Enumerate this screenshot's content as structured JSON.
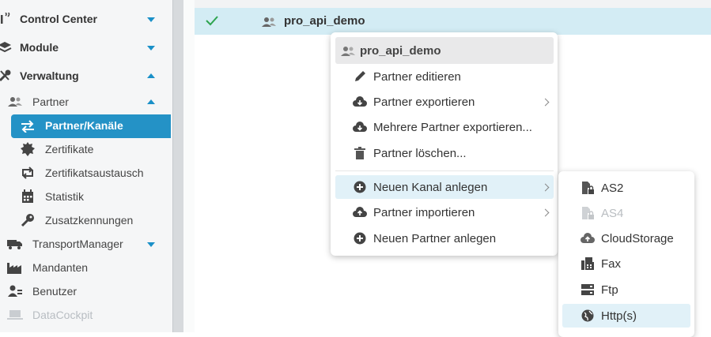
{
  "sidebar": {
    "top_items": [
      {
        "label": "Control Center"
      },
      {
        "label": "Module"
      },
      {
        "label": "Verwaltung"
      }
    ],
    "partner": {
      "label": "Partner"
    },
    "partner_children": [
      {
        "label": "Partner/Kanäle"
      },
      {
        "label": "Zertifikate"
      },
      {
        "label": "Zertifikatsaustausch"
      },
      {
        "label": "Statistik"
      },
      {
        "label": "Zusatzkennungen"
      }
    ],
    "other_items": [
      {
        "label": "TransportManager"
      },
      {
        "label": "Mandanten"
      },
      {
        "label": "Benutzer"
      },
      {
        "label": "DataCockpit"
      }
    ]
  },
  "list": {
    "selected_row": {
      "name": "pro_api_demo"
    }
  },
  "context_menu": {
    "header": "pro_api_demo",
    "items": [
      {
        "label": "Partner editieren"
      },
      {
        "label": "Partner exportieren"
      },
      {
        "label": "Mehrere Partner exportieren..."
      },
      {
        "label": "Partner löschen..."
      },
      {
        "label": "Neuen Kanal anlegen"
      },
      {
        "label": "Partner importieren"
      },
      {
        "label": "Neuen Partner anlegen"
      }
    ]
  },
  "submenu": {
    "items": [
      {
        "label": "AS2"
      },
      {
        "label": "AS4"
      },
      {
        "label": "CloudStorage"
      },
      {
        "label": "Fax"
      },
      {
        "label": "Ftp"
      },
      {
        "label": "Http(s)"
      }
    ]
  },
  "colors": {
    "accent": "#2492c6",
    "selected_row": "#d3ecf4",
    "check": "#2ea44f"
  }
}
